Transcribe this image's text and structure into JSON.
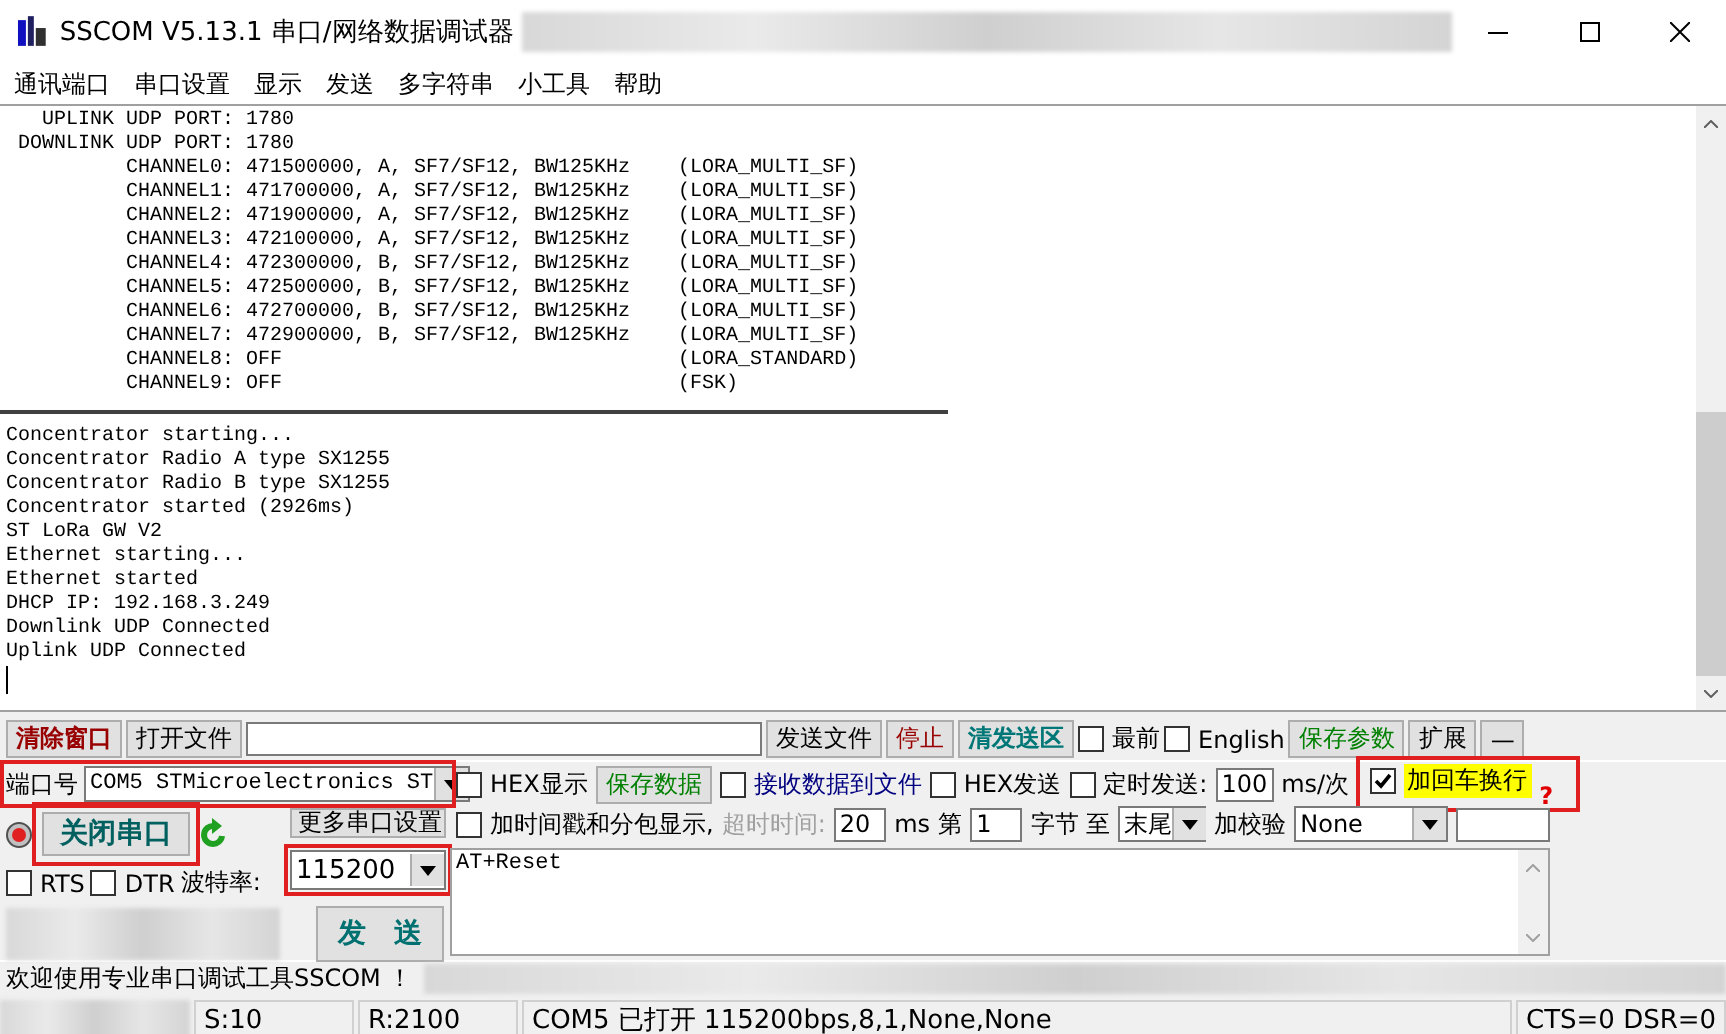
{
  "window": {
    "title": "SSCOM V5.13.1 串口/网络数据调试器"
  },
  "menu": [
    "通讯端口",
    "串口设置",
    "显示",
    "发送",
    "多字符串",
    "小工具",
    "帮助"
  ],
  "receive_log": {
    "header_lines": [
      "   UPLINK UDP PORT: 1780",
      " DOWNLINK UDP PORT: 1780",
      "          CHANNEL0: 471500000, A, SF7/SF12, BW125KHz    (LORA_MULTI_SF)",
      "          CHANNEL1: 471700000, A, SF7/SF12, BW125KHz    (LORA_MULTI_SF)",
      "          CHANNEL2: 471900000, A, SF7/SF12, BW125KHz    (LORA_MULTI_SF)",
      "          CHANNEL3: 472100000, A, SF7/SF12, BW125KHz    (LORA_MULTI_SF)",
      "          CHANNEL4: 472300000, B, SF7/SF12, BW125KHz    (LORA_MULTI_SF)",
      "          CHANNEL5: 472500000, B, SF7/SF12, BW125KHz    (LORA_MULTI_SF)",
      "          CHANNEL6: 472700000, B, SF7/SF12, BW125KHz    (LORA_MULTI_SF)",
      "          CHANNEL7: 472900000, B, SF7/SF12, BW125KHz    (LORA_MULTI_SF)",
      "          CHANNEL8: OFF                                 (LORA_STANDARD)",
      "          CHANNEL9: OFF                                 (FSK)"
    ],
    "body_lines": [
      "Concentrator starting...",
      "Concentrator Radio A type SX1255",
      "Concentrator Radio B type SX1255",
      "Concentrator started (2926ms)",
      "ST LoRa GW V2",
      "Ethernet starting...",
      "Ethernet started",
      "DHCP IP: 192.168.3.249",
      "Downlink UDP Connected",
      "Uplink UDP Connected"
    ]
  },
  "toolbar": [
    {
      "kind": "strong-button",
      "label": "清除窗口",
      "color": "#990000"
    },
    {
      "kind": "button",
      "label": "打开文件"
    },
    {
      "kind": "field"
    },
    {
      "kind": "button",
      "label": "发送文件"
    },
    {
      "kind": "button",
      "label": "停止",
      "color": "#990000"
    },
    {
      "kind": "strong-button",
      "label": "清发送区",
      "color": "#007777"
    },
    {
      "kind": "checkbox",
      "label": "最前",
      "checked": false
    },
    {
      "kind": "checkbox",
      "label": "English",
      "checked": false
    },
    {
      "kind": "button",
      "label": "保存参数",
      "color": "#008000"
    },
    {
      "kind": "button",
      "label": "扩展"
    },
    {
      "kind": "button",
      "label": "—"
    }
  ],
  "port_panel": {
    "port_label": "端口号",
    "port": {
      "value": "COM5 STMicroelectronics ST",
      "annotated": true
    },
    "open_button": {
      "label": "关闭串口",
      "annotated": true
    },
    "more_settings_button": "更多串口设置",
    "rts": {
      "label": "RTS",
      "checked": false
    },
    "dtr": {
      "label": "DTR",
      "checked": false
    },
    "baud_label": "波特率:",
    "baud": {
      "value": "115200",
      "annotated": true
    },
    "send_button": "发　送"
  },
  "options_row_1": [
    {
      "kind": "checkbox",
      "label": "HEX显示",
      "checked": false,
      "annotated": false
    },
    {
      "kind": "button",
      "label": "保存数据",
      "color": "#008000",
      "annotated": false
    },
    {
      "kind": "checkbox",
      "label": "接收数据到文件",
      "checked": false,
      "color": "#000080",
      "annotated": false
    },
    {
      "kind": "checkbox",
      "label": "HEX发送",
      "checked": false,
      "annotated": false
    },
    {
      "kind": "checkbox",
      "label": "定时发送:",
      "checked": false,
      "annotated": false
    },
    {
      "kind": "field",
      "value": "100",
      "annotated": false
    },
    {
      "kind": "text",
      "label": "ms/次",
      "annotated": false
    },
    {
      "kind": "checkbox",
      "label": "加回车换行",
      "checked": true,
      "highlight": true,
      "suffix": "?",
      "annotated": true
    }
  ],
  "options_row_2": [
    {
      "kind": "checkbox",
      "label": "加时间戳和分包显示,",
      "checked": false
    },
    {
      "kind": "hint",
      "label": "超时时间:"
    },
    {
      "kind": "field",
      "value": "20"
    },
    {
      "kind": "text",
      "label": "ms"
    },
    {
      "kind": "text",
      "label": "第"
    },
    {
      "kind": "field",
      "value": "1"
    },
    {
      "kind": "text",
      "label": "字节 至"
    },
    {
      "kind": "combo",
      "value": "末尾"
    },
    {
      "kind": "text",
      "label": "加校验"
    },
    {
      "kind": "combo",
      "value": "None",
      "wide": true
    },
    {
      "kind": "field"
    }
  ],
  "send_box": {
    "value": "AT+Reset"
  },
  "marquee": {
    "text": "欢迎使用专业串口调试工具SSCOM ！"
  },
  "status_bar": {
    "sent": "S:10",
    "received": "R:2100",
    "port_status": "COM5 已打开  115200bps,8,1,None,None",
    "lines": "CTS=0 DSR=0"
  }
}
